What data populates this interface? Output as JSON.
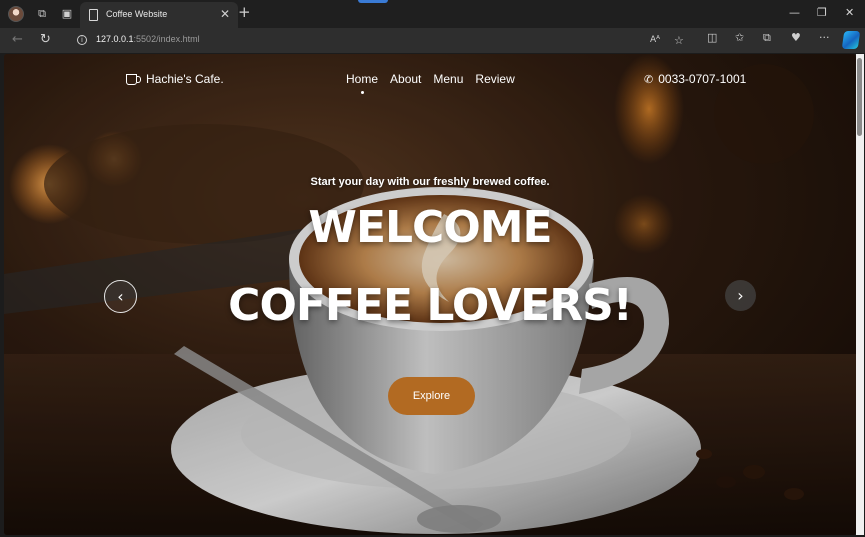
{
  "browser": {
    "tab_title": "Coffee Website",
    "url_host": "127.0.0.1",
    "url_rest": ":5502/index.html",
    "icons": [
      "profile-avatar",
      "workspaces-icon",
      "tab-actions-icon",
      "page-icon",
      "close-icon",
      "plus-icon",
      "back-icon",
      "refresh-icon",
      "info-icon",
      "read-aloud-icon",
      "favorite-star-icon",
      "split-screen-icon",
      "favorites-icon",
      "collections-icon",
      "browser-essentials-icon",
      "more-icon",
      "copilot-icon"
    ]
  },
  "site": {
    "brand": "Hachie's Cafe.",
    "nav": [
      {
        "label": "Home",
        "active": true
      },
      {
        "label": "About",
        "active": false
      },
      {
        "label": "Menu",
        "active": false
      },
      {
        "label": "Review",
        "active": false
      }
    ],
    "phone": "0033-0707-1001"
  },
  "hero": {
    "tagline": "Start your day with our freshly brewed coffee.",
    "headline_line1": "WELCOME",
    "headline_line2": "COFFEE LOVERS!",
    "cta": "Explore",
    "prev_glyph": "‹",
    "next_glyph": "›"
  },
  "colors": {
    "accent": "#b26a22",
    "browser_bg": "#1f1f1f",
    "toolbar_bg": "#2e2e2e"
  }
}
